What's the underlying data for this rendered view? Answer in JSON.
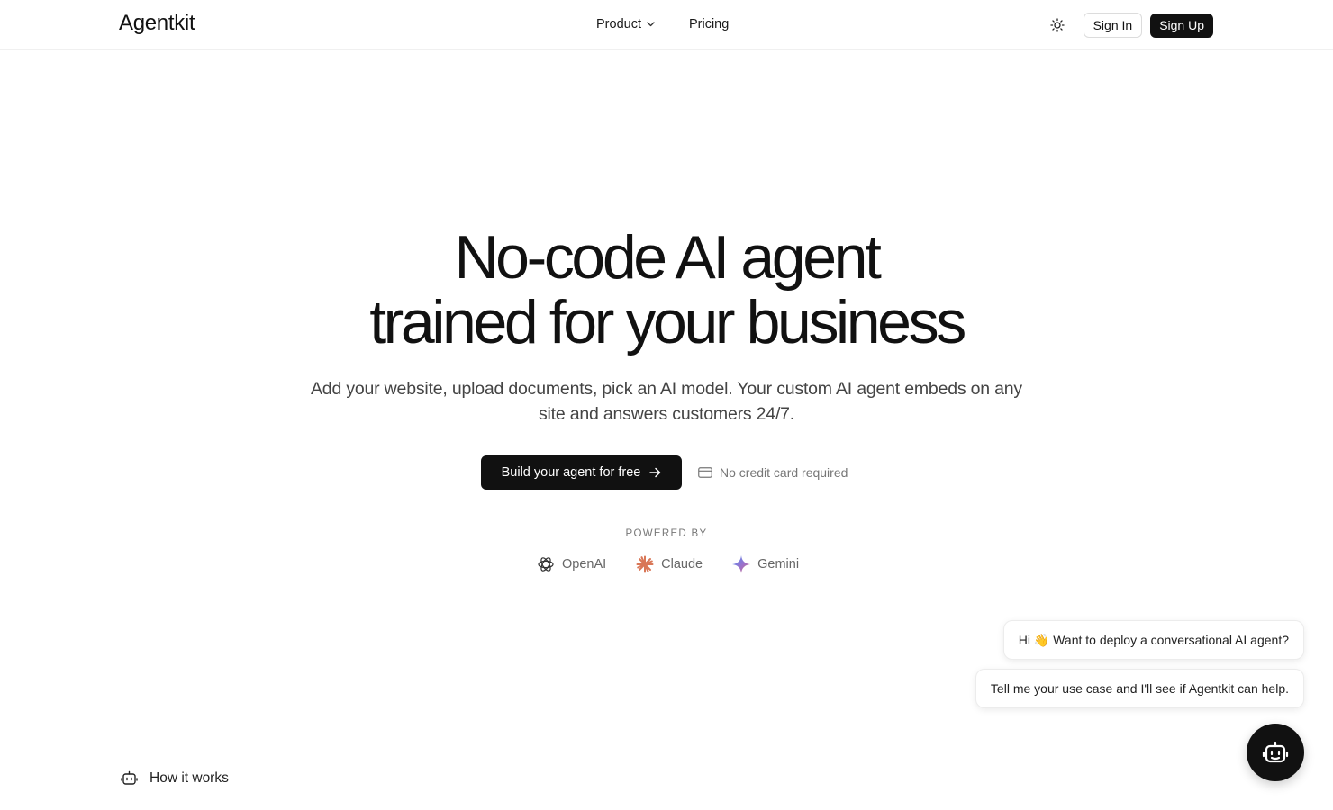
{
  "header": {
    "logo": "Agentkit",
    "nav": [
      {
        "label": "Product",
        "has_dropdown": true
      },
      {
        "label": "Pricing",
        "has_dropdown": false
      }
    ],
    "theme_icon": "sun-icon",
    "sign_in": "Sign In",
    "sign_up": "Sign Up"
  },
  "hero": {
    "title_line1": "No-code AI agent",
    "title_line2": "trained for your business",
    "subtitle": "Add your website, upload documents, pick an AI model. Your custom AI agent embeds on any site and answers customers 24/7.",
    "cta_label": "Build your agent for free",
    "cta_icon": "arrow-right-icon",
    "no_card_text": "No credit card required",
    "no_card_icon": "credit-card-icon"
  },
  "powered_by": {
    "label": "POWERED BY",
    "models": [
      {
        "name": "OpenAI",
        "icon": "openai-logo-icon"
      },
      {
        "name": "Claude",
        "icon": "claude-logo-icon",
        "color": "#D97757"
      },
      {
        "name": "Gemini",
        "icon": "gemini-logo-icon",
        "color": "#8E75C9"
      }
    ]
  },
  "chat": {
    "message1": "Hi 👋 Want to deploy a conversational AI agent?",
    "message2": "Tell me your use case and I'll see if Agentkit can help.",
    "launcher_icon": "bot-icon"
  },
  "footer_link": {
    "label": "How it works",
    "icon": "bot-icon"
  },
  "colors": {
    "primary": "#111111",
    "background": "#ffffff",
    "muted_text": "#777777"
  }
}
